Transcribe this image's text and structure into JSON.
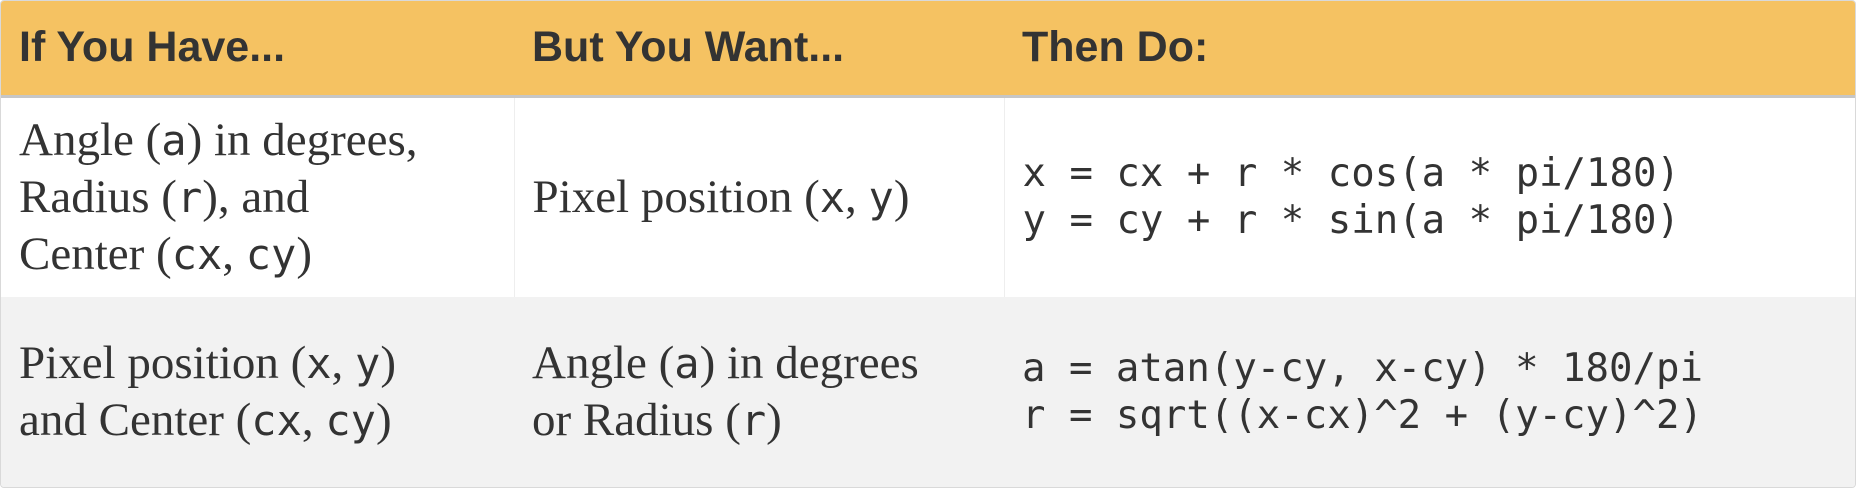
{
  "table": {
    "headers": [
      "If You Have...",
      "But You Want...",
      "Then Do:"
    ],
    "rows": [
      {
        "have": [
          [
            {
              "t": "Angle ("
            },
            {
              "v": "a"
            },
            {
              "t": ") in degrees,"
            }
          ],
          [
            {
              "t": "Radius ("
            },
            {
              "v": "r"
            },
            {
              "t": "), and"
            }
          ],
          [
            {
              "t": "Center ("
            },
            {
              "v": "cx"
            },
            {
              "t": ", "
            },
            {
              "v": "cy"
            },
            {
              "t": ")"
            }
          ]
        ],
        "want": [
          [
            {
              "t": "Pixel position ("
            },
            {
              "v": "x"
            },
            {
              "t": ", "
            },
            {
              "v": "y"
            },
            {
              "t": ")"
            }
          ]
        ],
        "code": [
          "x = cx + r * cos(a * pi/180)",
          "y = cy + r * sin(a * pi/180)"
        ]
      },
      {
        "have": [
          [
            {
              "t": "Pixel position ("
            },
            {
              "v": "x"
            },
            {
              "t": ", "
            },
            {
              "v": "y"
            },
            {
              "t": ")"
            }
          ],
          [
            {
              "t": "and Center ("
            },
            {
              "v": "cx"
            },
            {
              "t": ", "
            },
            {
              "v": "cy"
            },
            {
              "t": ")"
            }
          ]
        ],
        "want": [
          [
            {
              "t": "Angle ("
            },
            {
              "v": "a"
            },
            {
              "t": ") in degrees"
            }
          ],
          [
            {
              "t": "or Radius ("
            },
            {
              "v": "r"
            },
            {
              "t": ")"
            }
          ]
        ],
        "code": [
          "a = atan(y-cy, x-cy) * 180/pi",
          "r = sqrt((x-cx)^2 + (y-cy)^2)"
        ]
      }
    ]
  },
  "colors": {
    "header_bg": "#f5c262",
    "header_text": "#333333",
    "row_alt_bg": "#f2f2f2",
    "body_text": "#333333"
  }
}
